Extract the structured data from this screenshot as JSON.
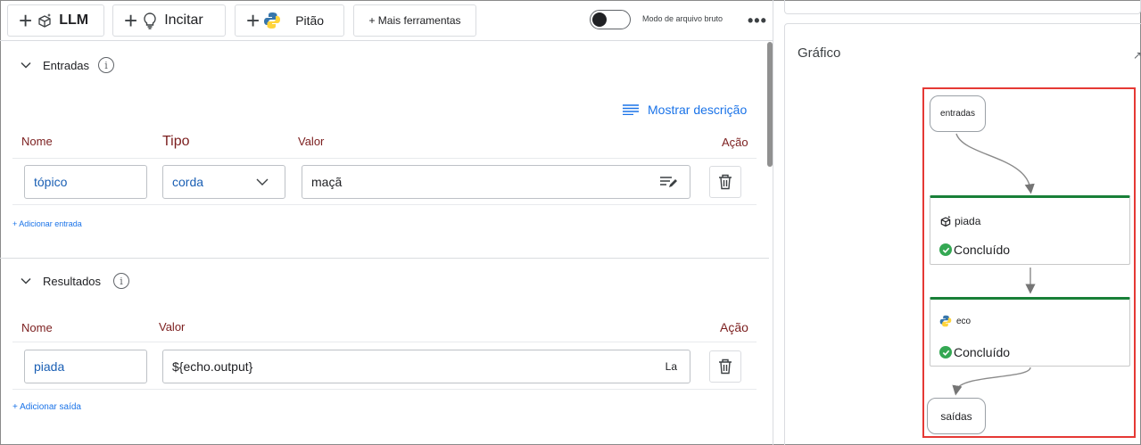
{
  "toolbar": {
    "llm_label": "LLM",
    "incitar_label": "Incitar",
    "pitao_label": "Pitão",
    "more_tools_label": "+ Mais ferramentas",
    "raw_mode_label": "Modo de arquivo bruto",
    "raw_mode_on": false,
    "more_menu_glyph": "•••"
  },
  "inputs": {
    "title": "Entradas",
    "info_glyph": "i",
    "show_description": "Mostrar descrição",
    "columns": {
      "name": "Nome",
      "type": "Tipo",
      "value": "Valor",
      "action": "Ação"
    },
    "rows": [
      {
        "name": "tópico",
        "type": "corda",
        "value": "maçã"
      }
    ],
    "add_label": "+ Adicionar entrada"
  },
  "outputs": {
    "title": "Resultados",
    "info_glyph": "i",
    "columns": {
      "name": "Nome",
      "value": "Valor",
      "action": "Ação"
    },
    "rows": [
      {
        "name": "piada",
        "value": "${echo.output}",
        "suffix": "La"
      }
    ],
    "add_label": "+ Adicionar saída"
  },
  "graph": {
    "title": "Gráfico",
    "expand_glyph": "↗",
    "nodes": {
      "start": "entradas",
      "n1_name": "piada",
      "n1_status": "Concluído",
      "n2_name": "eco",
      "n2_status": "Concluído",
      "end": "saídas"
    },
    "status_color": "#34a853",
    "accent_color": "#188038",
    "highlight_color": "#e53935"
  }
}
